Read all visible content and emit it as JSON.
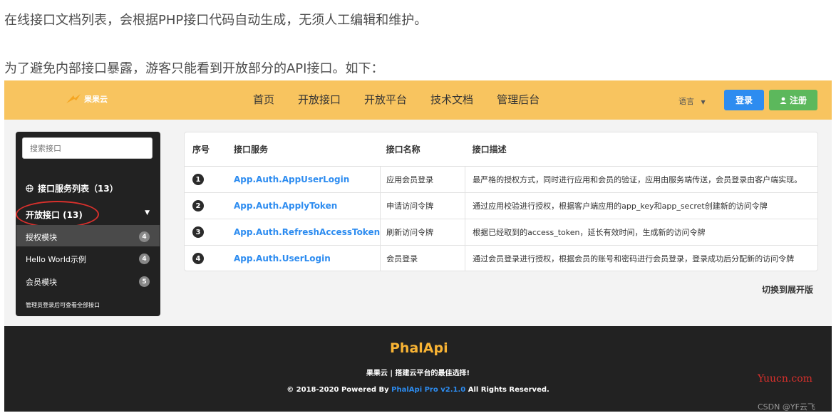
{
  "article": {
    "para1": "在线接口文档列表，会根据PHP接口代码自动生成，无须人工编辑和维护。",
    "para2": "为了避免内部接口暴露，游客只能看到开放部分的API接口。如下："
  },
  "navbar": {
    "logo_text": "果果云",
    "links": [
      "首页",
      "开放接口",
      "开放平台",
      "技术文档",
      "管理后台"
    ],
    "lang_label": "语言",
    "login_label": "登录",
    "register_label": "注册"
  },
  "sidebar": {
    "search_placeholder": "搜索接口",
    "section_title": "接口服务列表（13）",
    "group_label": "开放接口 (13)",
    "items": [
      {
        "label": "授权模块",
        "count": "4",
        "active": true
      },
      {
        "label": "Hello World示例",
        "count": "4"
      },
      {
        "label": "会员模块",
        "count": "5"
      }
    ],
    "note": "管理员登录后可查看全部接口"
  },
  "table": {
    "headers": [
      "序号",
      "接口服务",
      "接口名称",
      "接口描述"
    ],
    "rows": [
      {
        "no": "1",
        "service": "App.Auth.AppUserLogin",
        "name": "应用会员登录",
        "desc": "最严格的授权方式，同时进行应用和会员的验证，应用由服务端传送，会员登录由客户端实现。"
      },
      {
        "no": "2",
        "service": "App.Auth.ApplyToken",
        "name": "申请访问令牌",
        "desc": "通过应用校验进行授权，根据客户端应用的app_key和app_secret创建新的访问令牌"
      },
      {
        "no": "3",
        "service": "App.Auth.RefreshAccessToken",
        "name": "刷新访问令牌",
        "desc": "根据已经取到的access_token，延长有效时间，生成新的访问令牌"
      },
      {
        "no": "4",
        "service": "App.Auth.UserLogin",
        "name": "会员登录",
        "desc": "通过会员登录进行授权，根据会员的账号和密码进行会员登录，登录成功后分配新的访问令牌"
      }
    ],
    "toggle_label": "切换到展开版"
  },
  "footer": {
    "logo_text": "PhalApi",
    "slogan": "果果云 | 搭建云平台的最佳选择!",
    "copy_prefix": "© 2018-2020 Powered By ",
    "copy_highlight": "PhalApi Pro v2.1.0",
    "copy_suffix": " All Rights Reserved."
  },
  "watermarks": {
    "site": "Yuucn.com",
    "author": "CSDN @YF云飞"
  },
  "colors": {
    "navbar_bg": "#f8c45f",
    "login_btn": "#2d8cf0",
    "register_btn": "#5cb85c",
    "link": "#2d8cf0",
    "annotation_red": "#d9302c"
  }
}
